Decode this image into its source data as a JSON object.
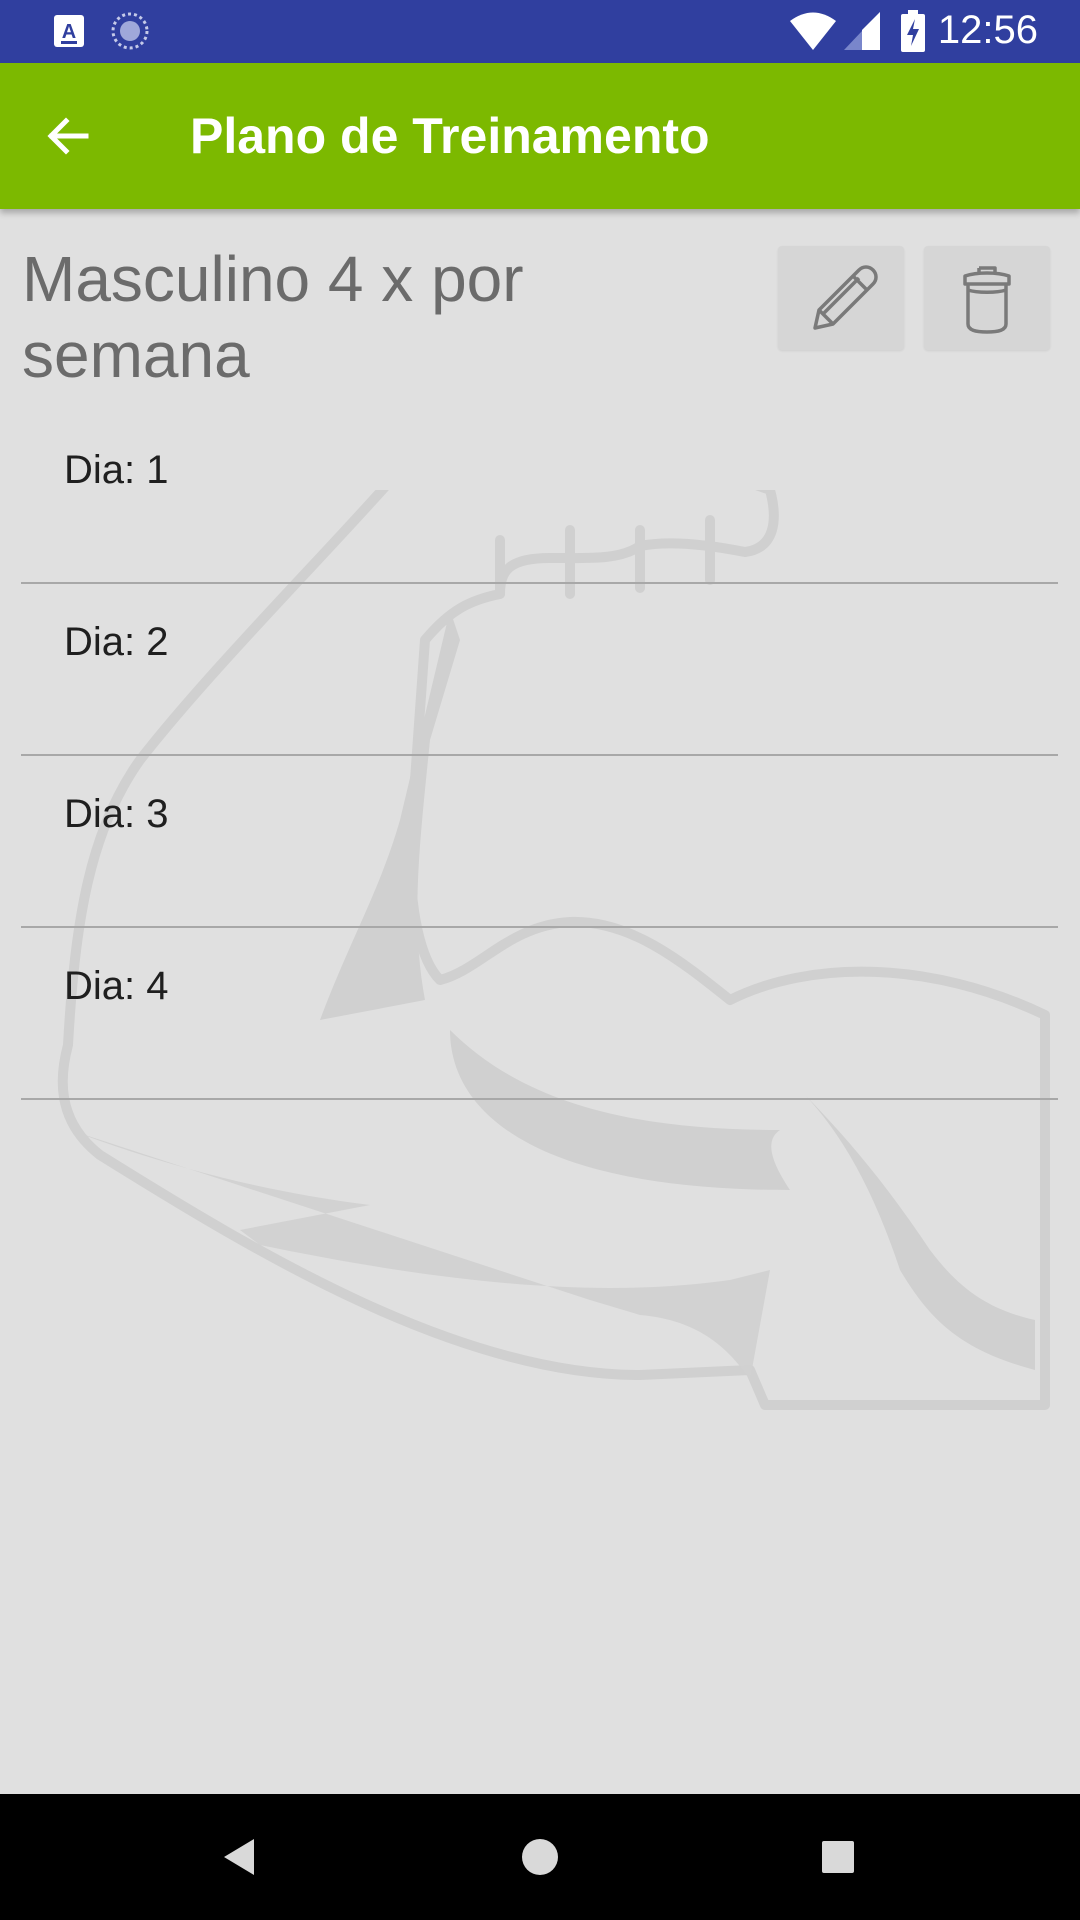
{
  "status_bar": {
    "time": "12:56",
    "color": "#303f9f"
  },
  "app_bar": {
    "title": "Plano de Treinamento",
    "color": "#7cb900"
  },
  "plan": {
    "title": "Masculino 4 x por semana"
  },
  "days": [
    {
      "label": "Dia: 1"
    },
    {
      "label": "Dia: 2"
    },
    {
      "label": "Dia: 3"
    },
    {
      "label": "Dia: 4"
    }
  ],
  "icons": {
    "back": "arrow-back-icon",
    "edit": "pencil-icon",
    "delete": "trash-icon",
    "watermark": "flexed-arm-icon",
    "nav_back": "triangle-back-icon",
    "nav_home": "circle-home-icon",
    "nav_recents": "square-recents-icon"
  }
}
